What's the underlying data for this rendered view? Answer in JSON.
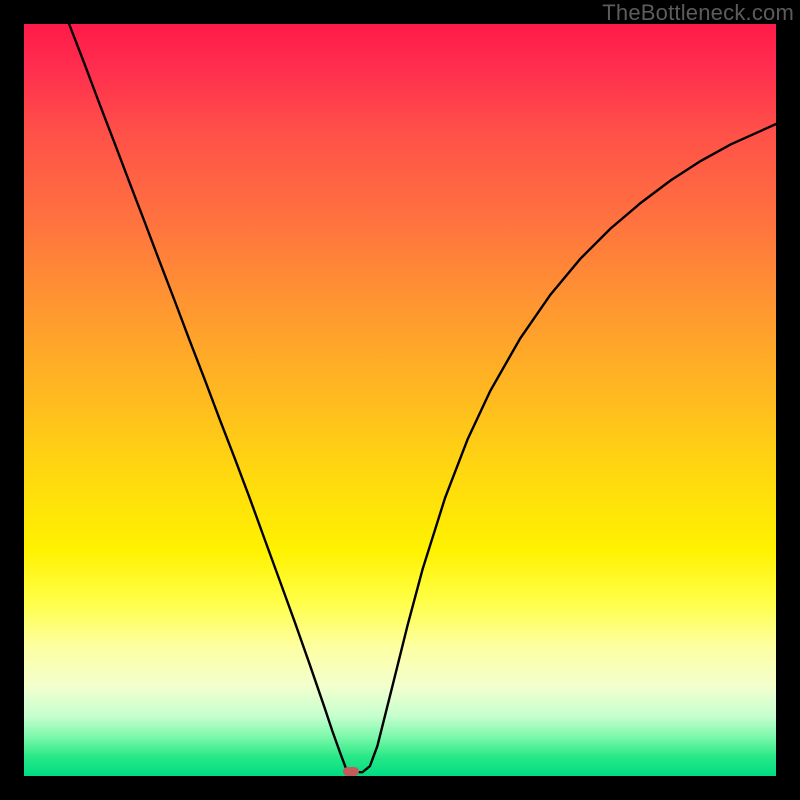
{
  "watermark": "TheBottleneck.com",
  "marker": {
    "x_frac": 0.435,
    "y_frac": 0.993
  },
  "chart_data": {
    "type": "line",
    "title": "",
    "xlabel": "",
    "ylabel": "",
    "xlim": [
      0,
      1
    ],
    "ylim": [
      0,
      1
    ],
    "series": [
      {
        "name": "bottleneck-curve",
        "x": [
          0.06,
          0.08,
          0.1,
          0.12,
          0.14,
          0.16,
          0.18,
          0.2,
          0.22,
          0.24,
          0.26,
          0.28,
          0.3,
          0.32,
          0.34,
          0.36,
          0.38,
          0.4,
          0.41,
          0.42,
          0.43,
          0.45,
          0.46,
          0.47,
          0.49,
          0.51,
          0.53,
          0.56,
          0.59,
          0.62,
          0.66,
          0.7,
          0.74,
          0.78,
          0.82,
          0.86,
          0.9,
          0.94,
          0.98,
          1.0
        ],
        "y": [
          1.0,
          0.948,
          0.895,
          0.843,
          0.79,
          0.738,
          0.685,
          0.633,
          0.58,
          0.528,
          0.475,
          0.423,
          0.37,
          0.315,
          0.26,
          0.205,
          0.148,
          0.09,
          0.06,
          0.032,
          0.005,
          0.005,
          0.013,
          0.04,
          0.12,
          0.2,
          0.275,
          0.37,
          0.448,
          0.512,
          0.582,
          0.64,
          0.688,
          0.728,
          0.762,
          0.792,
          0.818,
          0.84,
          0.858,
          0.867
        ]
      }
    ],
    "gradient_stops": [
      {
        "pos": 0.0,
        "color": "#ff1a49"
      },
      {
        "pos": 0.5,
        "color": "#ffbb1f"
      },
      {
        "pos": 0.7,
        "color": "#fff200"
      },
      {
        "pos": 0.88,
        "color": "#f3ffcd"
      },
      {
        "pos": 1.0,
        "color": "#00dd83"
      }
    ]
  }
}
